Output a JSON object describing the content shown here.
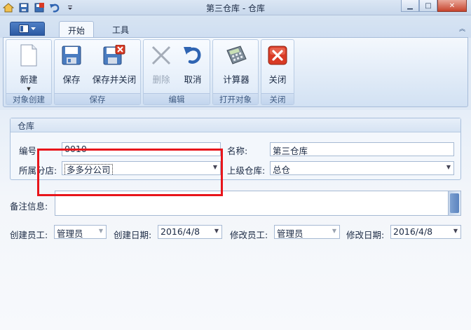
{
  "window": {
    "title": "第三仓库 - 仓库",
    "controls": {
      "minimize": "▁",
      "maximize": "□",
      "close": "✕"
    }
  },
  "tabs": [
    {
      "label": "开始",
      "active": true
    },
    {
      "label": "工具",
      "active": false
    }
  ],
  "ribbon": {
    "groups": [
      {
        "label": "对象创建",
        "buttons": [
          {
            "label": "新建",
            "icon": "new-document-icon",
            "has_dropdown": true,
            "disabled": false
          }
        ]
      },
      {
        "label": "保存",
        "buttons": [
          {
            "label": "保存",
            "icon": "save-icon",
            "disabled": false
          },
          {
            "label": "保存并关闭",
            "icon": "save-close-icon",
            "disabled": false
          }
        ]
      },
      {
        "label": "编辑",
        "buttons": [
          {
            "label": "删除",
            "icon": "delete-x-icon",
            "disabled": true
          },
          {
            "label": "取消",
            "icon": "undo-icon",
            "disabled": false
          }
        ]
      },
      {
        "label": "打开对象",
        "buttons": [
          {
            "label": "计算器",
            "icon": "calculator-icon",
            "disabled": false
          }
        ]
      },
      {
        "label": "关闭",
        "buttons": [
          {
            "label": "关闭",
            "icon": "close-red-icon",
            "disabled": false
          }
        ]
      }
    ]
  },
  "warehouse": {
    "section_title": "仓库",
    "code_label": "编号:",
    "code_value": "0010",
    "name_label": "名称:",
    "name_value": "第三仓库",
    "branch_label": "所属分店:",
    "branch_value": "多多分公司",
    "parent_label": "上级仓库:",
    "parent_value": "总仓"
  },
  "remarks": {
    "label": "备注信息:",
    "value": ""
  },
  "footer": {
    "creator_label": "创建员工:",
    "creator_value": "管理员",
    "created_label": "创建日期:",
    "created_value": "2016/4/8",
    "modifier_label": "修改员工:",
    "modifier_value": "管理员",
    "modified_label": "修改日期:",
    "modified_value": "2016/4/8"
  },
  "colors": {
    "accent": "#2c5aa3",
    "highlight_box": "#e8151b",
    "close_button": "#d93a25"
  }
}
